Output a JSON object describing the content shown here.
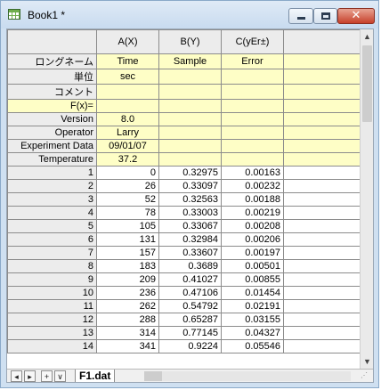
{
  "window": {
    "title": "Book1 *"
  },
  "columns": [
    {
      "header": "A(X)"
    },
    {
      "header": "B(Y)"
    },
    {
      "header": "C(yEr±)"
    }
  ],
  "label_rows": [
    {
      "name": "ロングネーム",
      "values": [
        "Time",
        "Sample",
        "Error"
      ]
    },
    {
      "name": "単位",
      "values": [
        "sec",
        "",
        ""
      ]
    },
    {
      "name": "コメント",
      "values": [
        "",
        "",
        ""
      ]
    },
    {
      "name": "F(x)=",
      "values": [
        "",
        "",
        ""
      ]
    },
    {
      "name": "Version",
      "values": [
        "8.0",
        "",
        ""
      ]
    },
    {
      "name": "Operator",
      "values": [
        "Larry",
        "",
        ""
      ]
    },
    {
      "name": "Experiment Data",
      "values": [
        "09/01/07",
        "",
        ""
      ]
    },
    {
      "name": "Temperature",
      "values": [
        "37.2",
        "",
        ""
      ]
    }
  ],
  "data_rows": [
    {
      "idx": "1",
      "values": [
        "0",
        "0.32975",
        "0.00163"
      ]
    },
    {
      "idx": "2",
      "values": [
        "26",
        "0.33097",
        "0.00232"
      ]
    },
    {
      "idx": "3",
      "values": [
        "52",
        "0.32563",
        "0.00188"
      ]
    },
    {
      "idx": "4",
      "values": [
        "78",
        "0.33003",
        "0.00219"
      ]
    },
    {
      "idx": "5",
      "values": [
        "105",
        "0.33067",
        "0.00208"
      ]
    },
    {
      "idx": "6",
      "values": [
        "131",
        "0.32984",
        "0.00206"
      ]
    },
    {
      "idx": "7",
      "values": [
        "157",
        "0.33607",
        "0.00197"
      ]
    },
    {
      "idx": "8",
      "values": [
        "183",
        "0.3689",
        "0.00501"
      ]
    },
    {
      "idx": "9",
      "values": [
        "209",
        "0.41027",
        "0.00855"
      ]
    },
    {
      "idx": "10",
      "values": [
        "236",
        "0.47106",
        "0.01454"
      ]
    },
    {
      "idx": "11",
      "values": [
        "262",
        "0.54792",
        "0.02191"
      ]
    },
    {
      "idx": "12",
      "values": [
        "288",
        "0.65287",
        "0.03155"
      ]
    },
    {
      "idx": "13",
      "values": [
        "314",
        "0.77145",
        "0.04327"
      ]
    },
    {
      "idx": "14",
      "values": [
        "341",
        "0.9224",
        "0.05546"
      ]
    }
  ],
  "sheet": {
    "tab_label": "F1.dat",
    "nav": [
      "◂",
      "▸",
      "+",
      "∨"
    ]
  },
  "icons": {
    "minimize": "minimize-icon",
    "maximize": "maximize-icon",
    "close": "close-icon"
  }
}
